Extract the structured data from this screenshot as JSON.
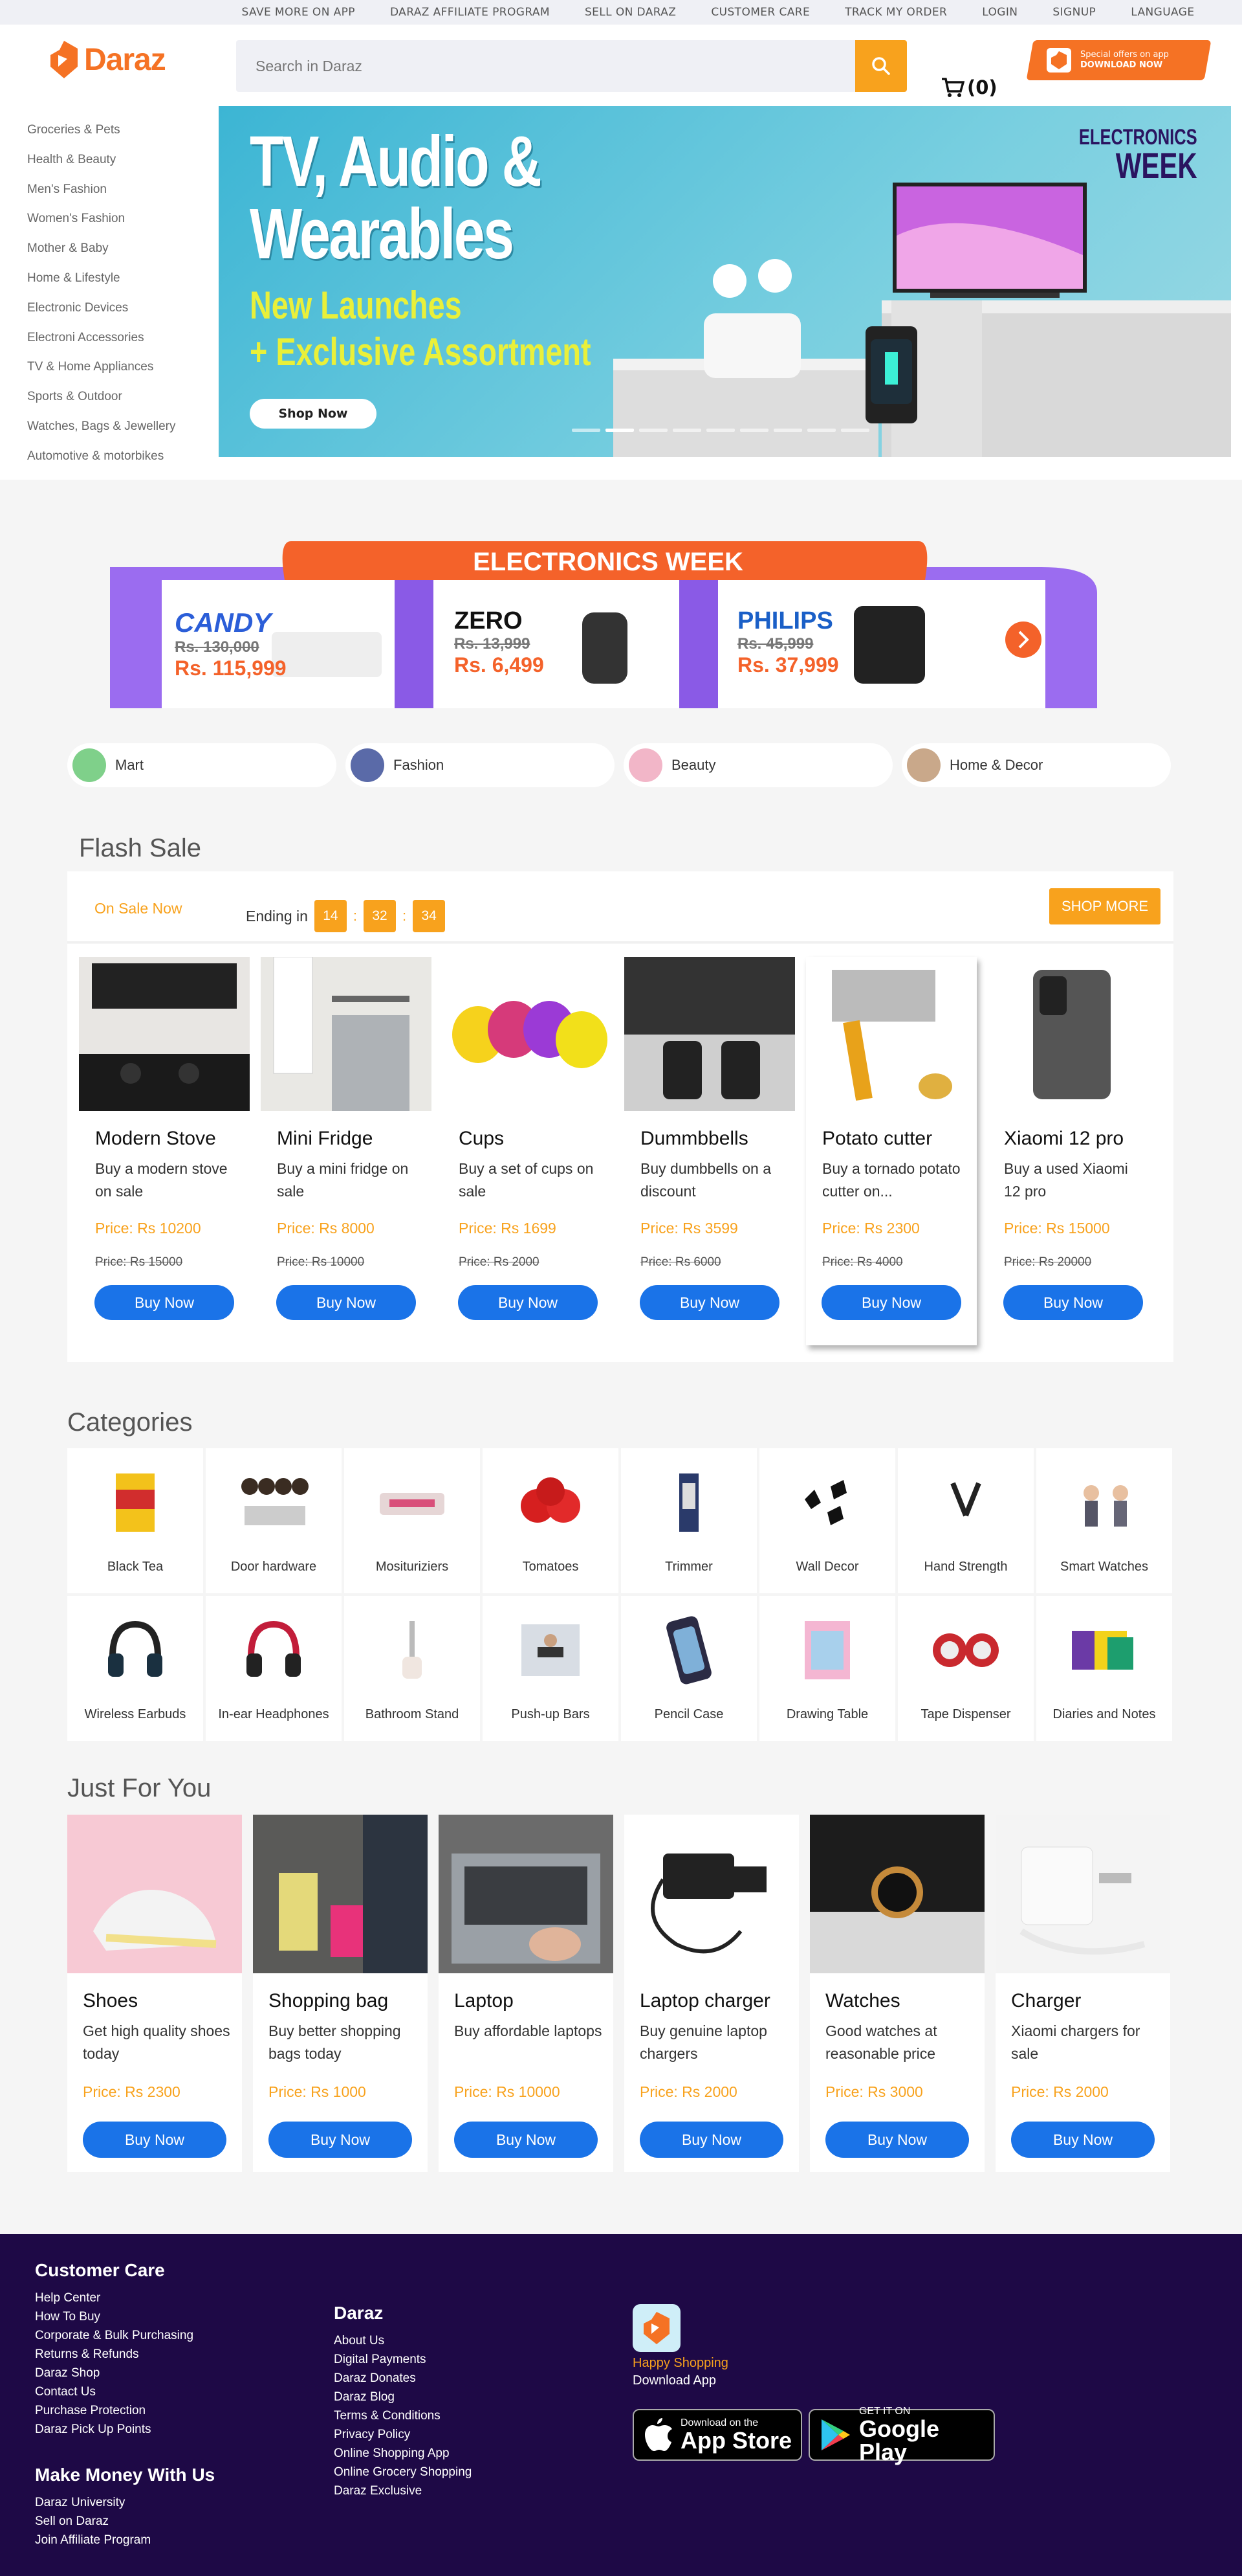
{
  "topbar": {
    "links": [
      "SAVE MORE ON APP",
      "DARAZ AFFILIATE PROGRAM",
      "SELL ON DARAZ",
      "CUSTOMER CARE",
      "TRACK MY ORDER",
      "LOGIN",
      "SIGNUP",
      "LANGUAGE"
    ]
  },
  "header": {
    "logo_text": "Daraz",
    "search_placeholder": "Search in Daraz",
    "cart_count": "(0)",
    "promo_line1": "Special offers on app",
    "promo_line2": "DOWNLOAD NOW"
  },
  "sidebar": {
    "categories": [
      "Groceries & Pets",
      "Health & Beauty",
      "Men's Fashion",
      "Women's Fashion",
      "Mother & Baby",
      "Home & Lifestyle",
      "Electronic Devices",
      "Electroni Accessories",
      "TV & Home Appliances",
      "Sports & Outdoor",
      "Watches, Bags & Jewellery",
      "Automotive & motorbikes"
    ]
  },
  "hero": {
    "title_line1": "TV, Audio &",
    "title_line2": "Wearables",
    "sub_line1": "New Launches",
    "sub_line2": "+ Exclusive Assortment",
    "shop_label": "Shop Now",
    "badge_line1": "ELECTRONICS",
    "badge_line2": "WEEK"
  },
  "electronics_week": {
    "title": "ELECTRONICS WEEK",
    "deals": [
      {
        "brand": "CANDY",
        "old": "Rs. 130,000",
        "new": "Rs. 115,999"
      },
      {
        "brand": "ZERO",
        "old": "Rs. 13,999",
        "new": "Rs. 6,499"
      },
      {
        "brand": "PHILIPS",
        "old": "Rs. 45,999",
        "new": "Rs. 37,999"
      }
    ]
  },
  "chips": [
    "Mart",
    "Fashion",
    "Beauty",
    "Home & Decor"
  ],
  "flash_sale": {
    "title": "Flash Sale",
    "on_sale": "On Sale Now",
    "ending_label": "Ending in",
    "timer": [
      "14",
      "32",
      "34"
    ],
    "shop_more": "SHOP MORE",
    "products": [
      {
        "name": "Modern Stove",
        "desc": "Buy a modern stove on sale",
        "price": "Price: Rs 10200",
        "old": "Price: Rs 15000",
        "buy": "Buy Now"
      },
      {
        "name": "Mini Fridge",
        "desc": "Buy a mini fridge on sale",
        "price": "Price: Rs 8000",
        "old": "Price: Rs 10000",
        "buy": "Buy Now"
      },
      {
        "name": "Cups",
        "desc": "Buy a set of cups on sale",
        "price": "Price: Rs 1699",
        "old": "Price: Rs 2000",
        "buy": "Buy Now"
      },
      {
        "name": "Dummbbells",
        "desc": "Buy dumbbells on a discount",
        "price": "Price: Rs 3599",
        "old": "Price: Rs 6000",
        "buy": "Buy Now"
      },
      {
        "name": "Potato cutter",
        "desc": "Buy a tornado potato cutter on...",
        "price": "Price: Rs 2300",
        "old": "Price: Rs 4000",
        "buy": "Buy Now"
      },
      {
        "name": "Xiaomi 12 pro",
        "desc": "Buy a used Xiaomi 12 pro",
        "price": "Price: Rs 15000",
        "old": "Price: Rs 20000",
        "buy": "Buy Now"
      }
    ]
  },
  "categories": {
    "title": "Categories",
    "items": [
      "Black Tea",
      "Door hardware",
      "Mosituriziers",
      "Tomatoes",
      "Trimmer",
      "Wall Decor",
      "Hand Strength",
      "Smart Watches",
      "Wireless Earbuds",
      "In-ear Headphones",
      "Bathroom Stand",
      "Push-up Bars",
      "Pencil Case",
      "Drawing Table",
      "Tape Dispenser",
      "Diaries and Notes"
    ]
  },
  "just_for_you": {
    "title": "Just For You",
    "products": [
      {
        "name": "Shoes",
        "desc": "Get high quality shoes today",
        "price": "Price: Rs 2300",
        "buy": "Buy Now"
      },
      {
        "name": "Shopping bag",
        "desc": "Buy better shopping bags today",
        "price": "Price: Rs 1000",
        "buy": "Buy Now"
      },
      {
        "name": "Laptop",
        "desc": "Buy affordable laptops",
        "price": "Price: Rs 10000",
        "buy": "Buy Now"
      },
      {
        "name": "Laptop charger",
        "desc": "Buy genuine laptop chargers",
        "price": "Price: Rs 2000",
        "buy": "Buy Now"
      },
      {
        "name": "Watches",
        "desc": "Good watches at reasonable price",
        "price": "Price: Rs 3000",
        "buy": "Buy Now"
      },
      {
        "name": "Charger",
        "desc": "Xiaomi chargers for sale",
        "price": "Price: Rs 2000",
        "buy": "Buy Now"
      }
    ]
  },
  "footer": {
    "customer_care_title": "Customer Care",
    "customer_care": [
      "Help Center",
      "How To Buy",
      "Corporate & Bulk Purchasing",
      "Returns & Refunds",
      "Daraz Shop",
      "Contact Us",
      "Purchase Protection",
      "Daraz Pick Up Points"
    ],
    "make_money_title": "Make Money With Us",
    "make_money": [
      "Daraz University",
      "Sell on Daraz",
      "Join Affiliate Program"
    ],
    "daraz_title": "Daraz",
    "daraz_links": [
      "About Us",
      "Digital Payments",
      "Daraz Donates",
      "Daraz Blog",
      "Terms & Conditions",
      "Privacy Policy",
      "Online Shopping App",
      "Online Grocery Shopping",
      "Daraz Exclusive"
    ],
    "happy": "Happy Shopping",
    "download": "Download App",
    "appstore_small": "Download on the",
    "appstore_big": "App Store",
    "play_small": "GET IT ON",
    "play_big": "Google Play"
  }
}
